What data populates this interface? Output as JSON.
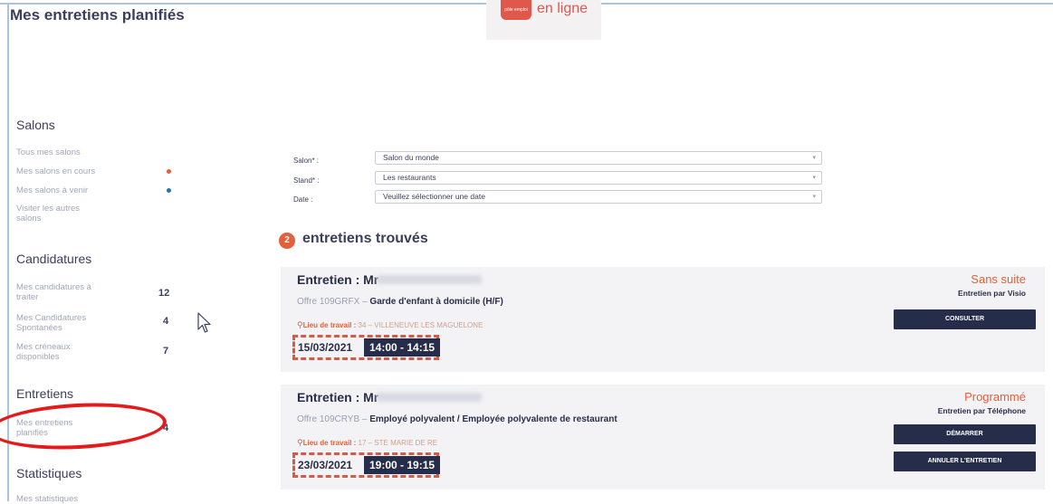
{
  "page": {
    "title": "Mes entretiens planifiés"
  },
  "logo": {
    "badge_text": "pôle emploi",
    "text": "en ligne"
  },
  "sidebar": {
    "salons": {
      "title": "Salons",
      "items": [
        {
          "label": "Tous mes salons"
        },
        {
          "label": "Mes salons en cours",
          "dot_color": "#e2603a"
        },
        {
          "label": "Mes salons à venir",
          "dot_color": "#2a6fb5"
        },
        {
          "label_l1": "Visiter les autres",
          "label_l2": "salons"
        }
      ]
    },
    "candidatures": {
      "title": "Candidatures",
      "items": [
        {
          "label_l1": "Mes candidatures à",
          "label_l2": "traiter",
          "count": "12"
        },
        {
          "label_l1": "Mes Candidatures",
          "label_l2": "Spontanées",
          "count": "4"
        },
        {
          "label_l1": "Mes créneaux",
          "label_l2": "disponibles",
          "count": "7"
        }
      ]
    },
    "entretiens": {
      "title": "Entretiens",
      "items": [
        {
          "label_l1": "Mes entretiens",
          "label_l2": "planifiés",
          "count": "4"
        }
      ]
    },
    "statistiques": {
      "title": "Statistiques",
      "items": [
        {
          "label": "Mes statistiques"
        }
      ]
    }
  },
  "filters": {
    "salon": {
      "label": "Salon* :",
      "value": "Salon du monde"
    },
    "stand": {
      "label": "Stand* :",
      "value": "Les restaurants"
    },
    "date": {
      "label": "Date :",
      "value": "Veuillez sélectionner une date"
    }
  },
  "results": {
    "count": "2",
    "text": "entretiens trouvés"
  },
  "interviews": [
    {
      "name": "Entretien : Mr",
      "offer_ref": "Offre 109GRFX –",
      "offer_title": "Garde d'enfant à domicile (H/F)",
      "location_label": "Lieu de travail :",
      "location_value": "34 – VILLENEUVE LES MAGUELONE",
      "date": "15/03/2021",
      "time": "14:00 - 14:15",
      "status": "Sans suite",
      "mode": "Entretien par Visio",
      "buttons": [
        "CONSULTER"
      ]
    },
    {
      "name": "Entretien : Mr",
      "offer_ref": "Offre 109CRYB –",
      "offer_title": "Employé polyvalent / Employée polyvalente de restaurant",
      "location_label": "Lieu de travail :",
      "location_value": "17 – STE MARIE DE RE",
      "date": "23/03/2021",
      "time": "19:00 - 19:15",
      "status": "Programmé",
      "mode": "Entretien par Téléphone",
      "buttons": [
        "DÉMARRER",
        "ANNULER L'ENTRETIEN"
      ]
    }
  ],
  "colors": {
    "accent": "#e2603a",
    "navy": "#262d4a",
    "annotation_red": "#e31b1b"
  },
  "icons": {
    "cursor": "mouse-pointer-icon",
    "location": "map-pin-icon",
    "caret": "chevron-down-icon"
  }
}
